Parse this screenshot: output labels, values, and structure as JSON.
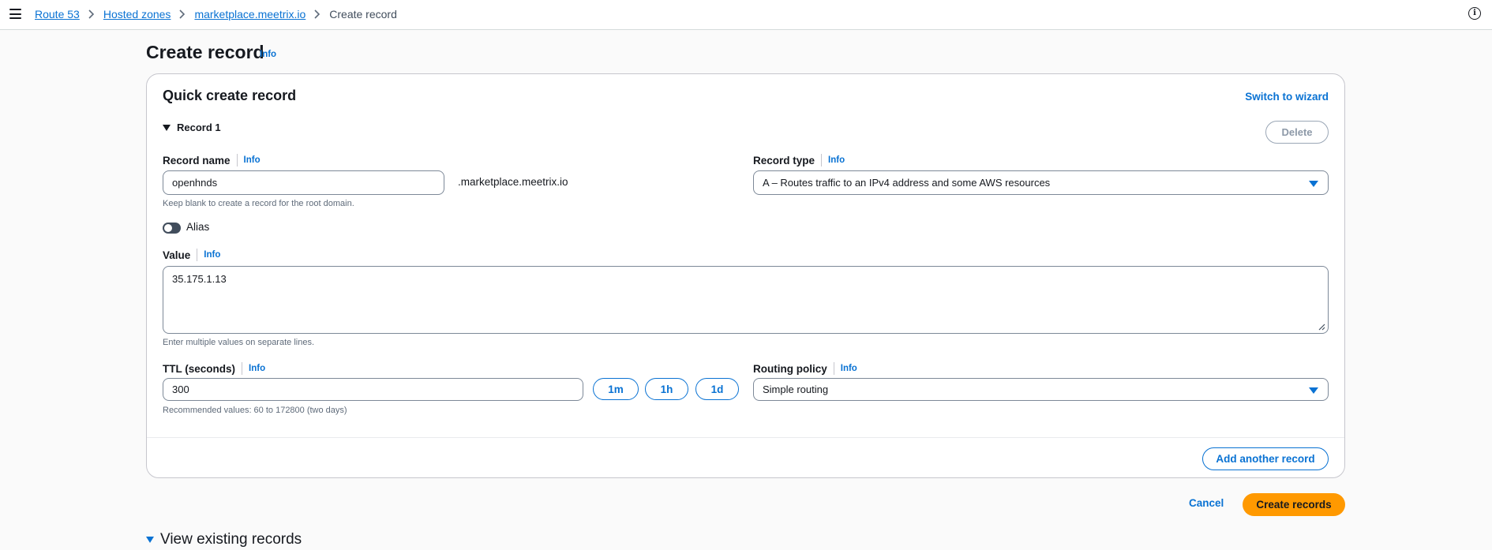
{
  "breadcrumb": {
    "items": [
      "Route 53",
      "Hosted zones",
      "marketplace.meetrix.io"
    ],
    "current": "Create record"
  },
  "page": {
    "title": "Create record",
    "info": "Info"
  },
  "panel": {
    "title": "Quick create record",
    "switch_wizard": "Switch to wizard",
    "record_toggle": "Record 1",
    "delete_label": "Delete",
    "record_name": {
      "label": "Record name",
      "info": "Info",
      "value": "openhnds",
      "suffix": ".marketplace.meetrix.io",
      "hint": "Keep blank to create a record for the root domain."
    },
    "record_type": {
      "label": "Record type",
      "info": "Info",
      "selected": "A – Routes traffic to an IPv4 address and some AWS resources"
    },
    "alias": {
      "label": "Alias",
      "enabled": false
    },
    "value": {
      "label": "Value",
      "info": "Info",
      "value": "35.175.1.13",
      "hint": "Enter multiple values on separate lines."
    },
    "ttl": {
      "label": "TTL (seconds)",
      "info": "Info",
      "value": "300",
      "hint": "Recommended values: 60 to 172800 (two days)",
      "presets": [
        "1m",
        "1h",
        "1d"
      ]
    },
    "routing_policy": {
      "label": "Routing policy",
      "info": "Info",
      "selected": "Simple routing"
    },
    "add_another": "Add another record"
  },
  "footer": {
    "cancel": "Cancel",
    "create": "Create records"
  },
  "existing": {
    "label": "View existing records"
  },
  "colors": {
    "accent": "#0972d3",
    "primary_button": "#ff9900"
  }
}
